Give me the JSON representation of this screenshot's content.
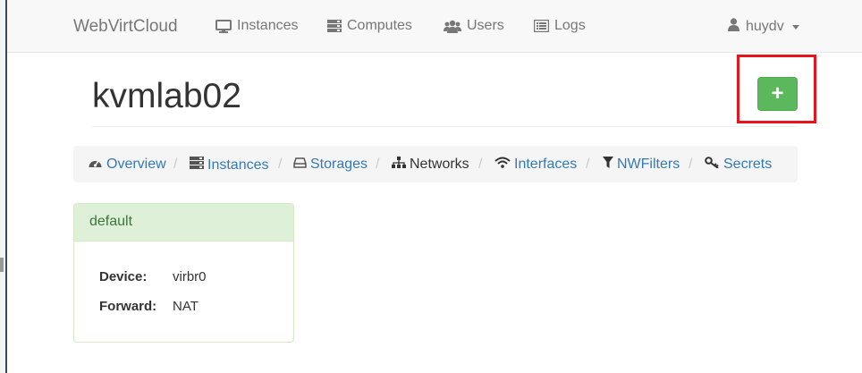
{
  "navbar": {
    "brand": "WebVirtCloud",
    "items": [
      {
        "label": "Instances",
        "icon": "desktop-icon"
      },
      {
        "label": "Computes",
        "icon": "server-icon"
      },
      {
        "label": "Users",
        "icon": "users-icon"
      },
      {
        "label": "Logs",
        "icon": "list-icon"
      }
    ],
    "user": {
      "label": "huydv",
      "icon": "user-icon"
    }
  },
  "page": {
    "title": "kvmlab02",
    "add_button_label": "+"
  },
  "breadcrumb": {
    "items": [
      {
        "label": "Overview",
        "icon": "dashboard-icon",
        "active": false
      },
      {
        "label": "Instances",
        "icon": "server-icon",
        "active": false
      },
      {
        "label": "Storages",
        "icon": "hdd-icon",
        "active": false
      },
      {
        "label": "Networks",
        "icon": "sitemap-icon",
        "active": true
      },
      {
        "label": "Interfaces",
        "icon": "wifi-icon",
        "active": false
      },
      {
        "label": "NWFilters",
        "icon": "filter-icon",
        "active": false
      },
      {
        "label": "Secrets",
        "icon": "key-icon",
        "active": false
      }
    ],
    "separator": "/"
  },
  "network_panel": {
    "name": "default",
    "fields": [
      {
        "key": "Device:",
        "value": "virbr0"
      },
      {
        "key": "Forward:",
        "value": "NAT"
      }
    ]
  },
  "colors": {
    "brand_text": "#777777",
    "link": "#337ab7",
    "success_button": "#5cb85c",
    "panel_heading_bg": "#dff0d8",
    "panel_heading_text": "#3c763d",
    "highlight_box": "#e8141c"
  }
}
